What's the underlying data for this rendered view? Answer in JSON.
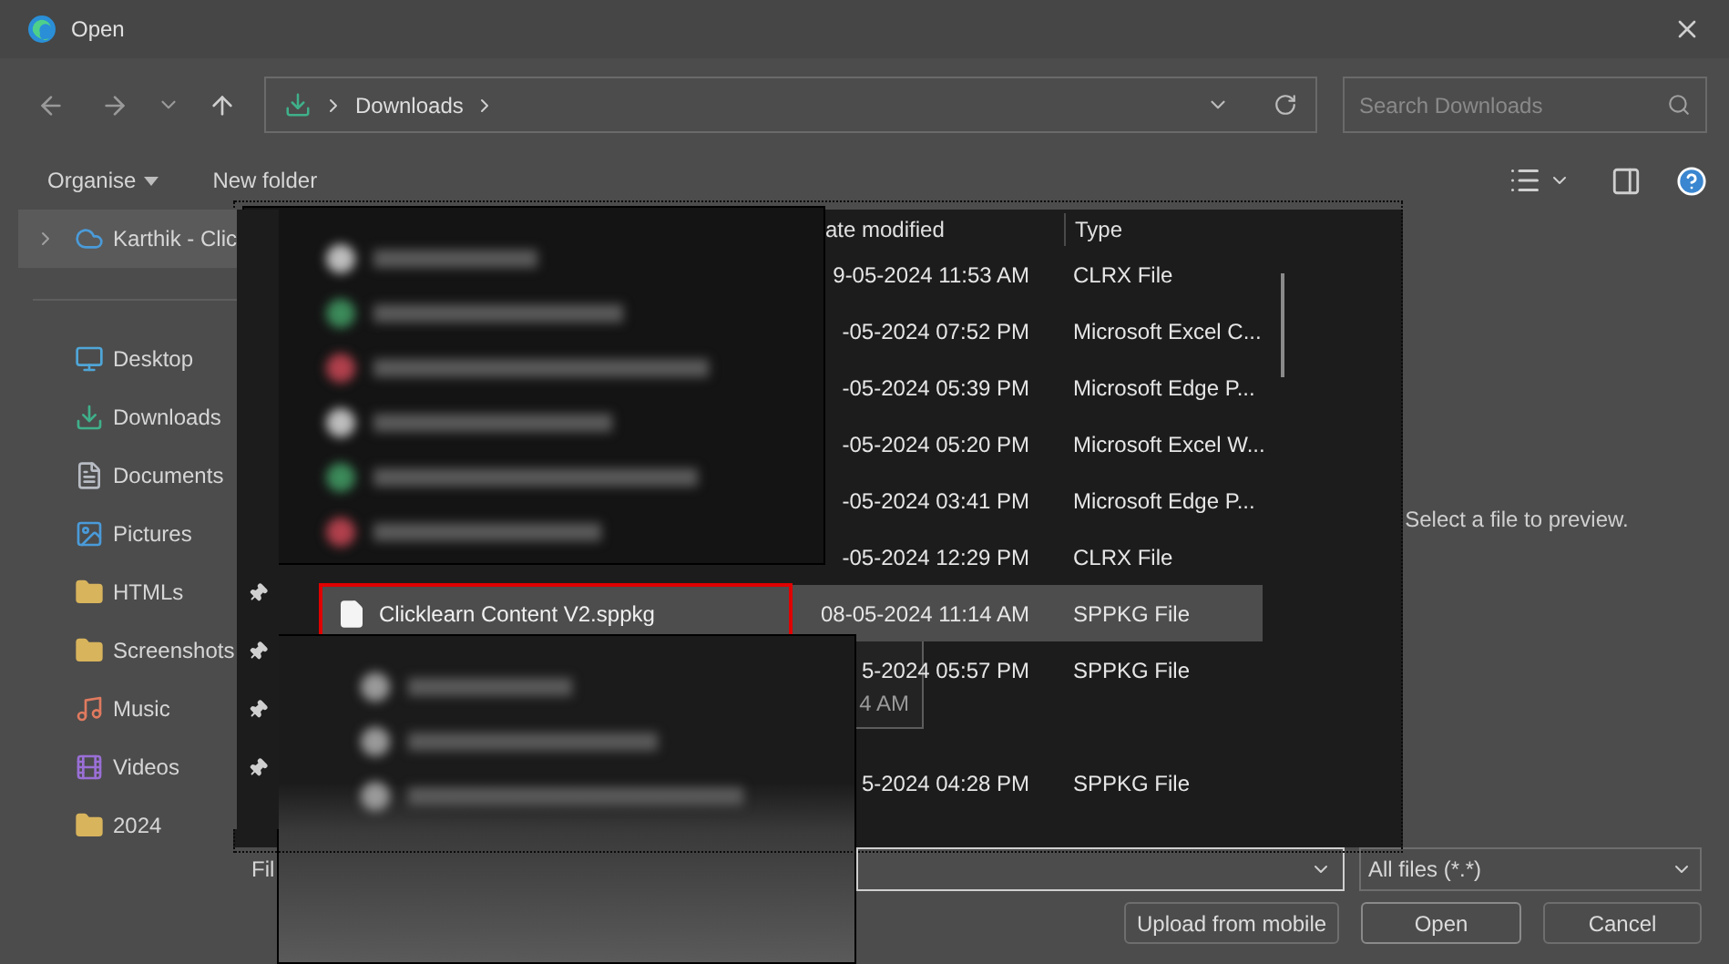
{
  "window": {
    "title": "Open"
  },
  "navigation": {
    "path": [
      {
        "label": "Downloads"
      }
    ],
    "search": {
      "placeholder": "Search Downloads"
    }
  },
  "toolbar": {
    "organise": "Organise",
    "new_folder": "New folder"
  },
  "sidebar": {
    "items": [
      {
        "label": "Karthik - Clic",
        "kind": "cloud",
        "selected": true,
        "pinned": false
      },
      {
        "label": "Desktop",
        "kind": "desktop",
        "selected": false,
        "pinned": false
      },
      {
        "label": "Downloads",
        "kind": "downloads",
        "selected": false,
        "pinned": false
      },
      {
        "label": "Documents",
        "kind": "documents",
        "selected": false,
        "pinned": false
      },
      {
        "label": "Pictures",
        "kind": "pictures",
        "selected": false,
        "pinned": false
      },
      {
        "label": "HTMLs",
        "kind": "folder",
        "selected": false,
        "pinned": true
      },
      {
        "label": "Screenshots",
        "kind": "folder",
        "selected": false,
        "pinned": true
      },
      {
        "label": "Music",
        "kind": "music",
        "selected": false,
        "pinned": true
      },
      {
        "label": "Videos",
        "kind": "videos",
        "selected": false,
        "pinned": true
      },
      {
        "label": "2024",
        "kind": "folder",
        "selected": false,
        "pinned": false
      }
    ]
  },
  "file_list": {
    "columns": [
      {
        "label": "ate modified"
      },
      {
        "label": "Type"
      }
    ],
    "rows": [
      {
        "date": "9-05-2024 11:53 AM",
        "type": "CLRX File",
        "selected": false
      },
      {
        "date": "-05-2024 07:52 PM",
        "type": "Microsoft Excel C...",
        "selected": false
      },
      {
        "date": "-05-2024 05:39 PM",
        "type": "Microsoft Edge P...",
        "selected": false
      },
      {
        "date": "-05-2024 05:20 PM",
        "type": "Microsoft Excel W...",
        "selected": false
      },
      {
        "date": "-05-2024 03:41 PM",
        "type": "Microsoft Edge P...",
        "selected": false
      },
      {
        "date": "-05-2024 12:29 PM",
        "type": "CLRX File",
        "selected": false
      },
      {
        "name": "Clicklearn Content V2.sppkg",
        "date": "08-05-2024 11:14 AM",
        "type": "SPPKG File",
        "selected": true,
        "highlighted": true
      },
      {
        "date": "5-2024 05:57 PM",
        "type": "SPPKG File",
        "selected": false
      },
      {
        "selected": false
      },
      {
        "date": "5-2024 04:28 PM",
        "type": "SPPKG File",
        "selected": false
      }
    ],
    "tooltip": {
      "text": "4 AM"
    }
  },
  "preview": {
    "message": "Select a file to preview."
  },
  "file_name": {
    "label": "Fil"
  },
  "filter": {
    "value": "All files (*.*)"
  },
  "buttons": [
    {
      "label": "Upload from mobile"
    },
    {
      "label": "Open"
    },
    {
      "label": "Cancel"
    }
  ]
}
